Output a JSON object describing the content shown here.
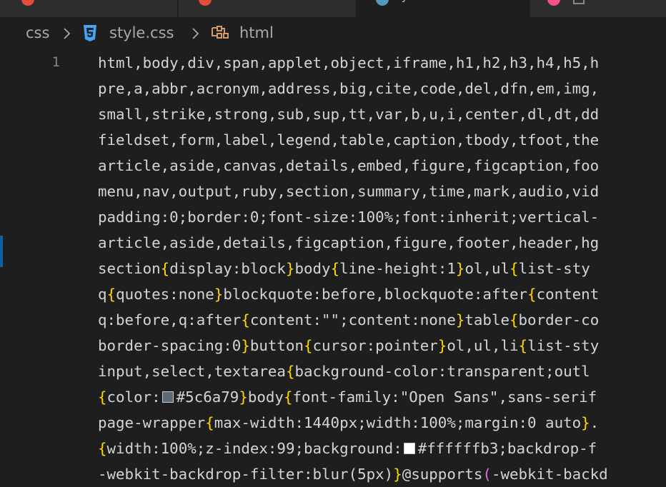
{
  "tabs": [
    {
      "label": "",
      "icon": "ruby-icon",
      "color": "#e44d3a"
    },
    {
      "label": "",
      "icon": "ruby-icon",
      "color": "#e44d3a"
    },
    {
      "label": "y",
      "icon": "css-icon",
      "color": "#519aba",
      "active": true
    },
    {
      "label": "",
      "icon": "file-icon",
      "color": "#f55385"
    }
  ],
  "breadcrumb": {
    "folder": "css",
    "file": "style.css",
    "symbol": "html"
  },
  "editor": {
    "line_number": "1",
    "lines": [
      [
        {
          "t": "html,body,div,span,applet,object,iframe,h1,h2,h3,h4,h5,h"
        }
      ],
      [
        {
          "t": "pre,a,abbr,acronym,address,big,cite,code,del,dfn,em,img,"
        }
      ],
      [
        {
          "t": "small,strike,strong,sub,sup,tt,var,b,u,i,center,dl,dt,dd"
        }
      ],
      [
        {
          "t": "fieldset,form,label,legend,table,caption,tbody,tfoot,the"
        }
      ],
      [
        {
          "t": "article,aside,canvas,details,embed,figure,figcaption,foo"
        }
      ],
      [
        {
          "t": "menu,nav,output,ruby,section,summary,time,mark,audio,vid"
        }
      ],
      [
        {
          "t": "padding:0;border:0;font-size:100%;font:inherit;vertical-"
        }
      ],
      [
        {
          "t": "article,aside,details,figcaption,figure,footer,header,hg"
        }
      ],
      [
        {
          "t": "section"
        },
        {
          "t": "{",
          "c": "bracket"
        },
        {
          "t": "display:block"
        },
        {
          "t": "}",
          "c": "bracket"
        },
        {
          "t": "body"
        },
        {
          "t": "{",
          "c": "bracket"
        },
        {
          "t": "line-height:1"
        },
        {
          "t": "}",
          "c": "bracket"
        },
        {
          "t": "ol,ul"
        },
        {
          "t": "{",
          "c": "bracket"
        },
        {
          "t": "list-sty"
        }
      ],
      [
        {
          "t": "q"
        },
        {
          "t": "{",
          "c": "bracket"
        },
        {
          "t": "quotes:none"
        },
        {
          "t": "}",
          "c": "bracket"
        },
        {
          "t": "blockquote:before,blockquote:after"
        },
        {
          "t": "{",
          "c": "bracket"
        },
        {
          "t": "content"
        }
      ],
      [
        {
          "t": "q:before,q:after"
        },
        {
          "t": "{",
          "c": "bracket"
        },
        {
          "t": "content:\"\";content:none"
        },
        {
          "t": "}",
          "c": "bracket"
        },
        {
          "t": "table"
        },
        {
          "t": "{",
          "c": "bracket"
        },
        {
          "t": "border-co"
        }
      ],
      [
        {
          "t": "border-spacing:0"
        },
        {
          "t": "}",
          "c": "bracket"
        },
        {
          "t": "button"
        },
        {
          "t": "{",
          "c": "bracket"
        },
        {
          "t": "cursor:pointer"
        },
        {
          "t": "}",
          "c": "bracket"
        },
        {
          "t": "ol,ul,li"
        },
        {
          "t": "{",
          "c": "bracket"
        },
        {
          "t": "list-sty"
        }
      ],
      [
        {
          "t": "input,select,textarea"
        },
        {
          "t": "{",
          "c": "bracket"
        },
        {
          "t": "background-color:transparent;outl"
        }
      ],
      [
        {
          "t": "{",
          "c": "bracket"
        },
        {
          "t": "color:"
        },
        {
          "swatch": "#5c6a79"
        },
        {
          "t": "#5c6a79"
        },
        {
          "t": "}",
          "c": "bracket"
        },
        {
          "t": "body"
        },
        {
          "t": "{",
          "c": "bracket"
        },
        {
          "t": "font-family:\"Open Sans\",sans-serif"
        }
      ],
      [
        {
          "t": "page-wrapper"
        },
        {
          "t": "{",
          "c": "bracket"
        },
        {
          "t": "max-width:1440px;width:100%;margin:0 auto"
        },
        {
          "t": "}",
          "c": "bracket"
        },
        {
          "t": "."
        }
      ],
      [
        {
          "t": "{",
          "c": "bracket"
        },
        {
          "t": "width:100%;z-index:99;background:"
        },
        {
          "swatch": "#ffffff"
        },
        {
          "t": "#ffffffb3;backdrop-f"
        }
      ],
      [
        {
          "t": "-webkit-backdrop-filter:blur(5px)"
        },
        {
          "t": "}",
          "c": "bracket"
        },
        {
          "t": "@supports"
        },
        {
          "t": "(",
          "c": "bracket2"
        },
        {
          "t": "-webkit-backd"
        }
      ]
    ]
  }
}
